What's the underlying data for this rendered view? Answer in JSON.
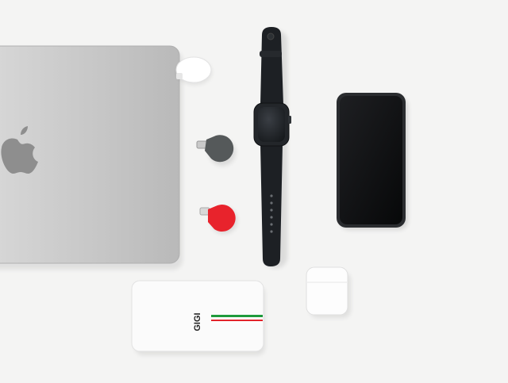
{
  "scene": {
    "background": "#f4f4f3",
    "items": [
      {
        "name": "laptop",
        "color": "#c9c9c9"
      },
      {
        "name": "apple-logo",
        "color": "#8e8e8e"
      },
      {
        "name": "charger-puck-white",
        "color": "#ffffff"
      },
      {
        "name": "charger-gray",
        "color": "#55595a"
      },
      {
        "name": "charger-red",
        "color": "#e8232c"
      },
      {
        "name": "smartwatch",
        "color": "#1b1e22"
      },
      {
        "name": "smartphone",
        "color": "#111214"
      },
      {
        "name": "power-bank",
        "color": "#fbfbfb"
      },
      {
        "name": "earbuds-case",
        "color": "#fdfdfd"
      }
    ]
  },
  "power_bank": {
    "brand": "GIGI",
    "stripe_colors": [
      "#1f9a3c",
      "#ffffff",
      "#e2232b"
    ]
  }
}
